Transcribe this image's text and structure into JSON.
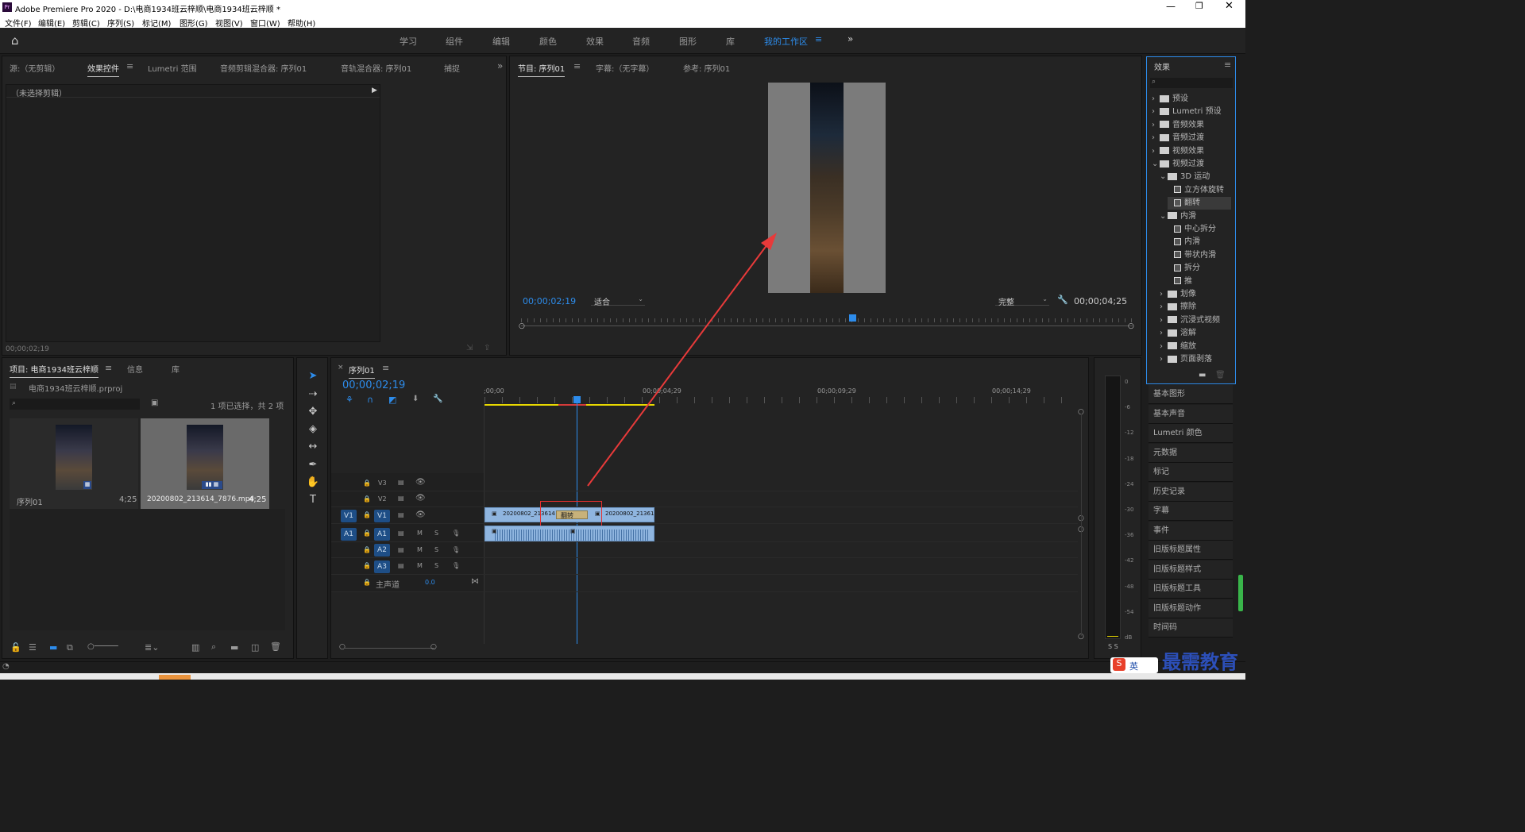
{
  "app": {
    "title": "Adobe Premiere Pro 2020 - D:\\电商1934班云梓顺\\电商1934班云梓顺 *",
    "menus": [
      "文件(F)",
      "编辑(E)",
      "剪辑(C)",
      "序列(S)",
      "标记(M)",
      "图形(G)",
      "视图(V)",
      "窗口(W)",
      "帮助(H)"
    ]
  },
  "workspaces": {
    "tabs": [
      "学习",
      "组件",
      "编辑",
      "颜色",
      "效果",
      "音频",
      "图形",
      "库"
    ],
    "active": "我的工作区",
    "more": "»"
  },
  "source_panel": {
    "tabs": [
      "源:（无剪辑）",
      "效果控件",
      "Lumetri 范围",
      "音频剪辑混合器: 序列01",
      "音轨混合器: 序列01",
      "捕捉"
    ],
    "no_clip": "（未选择剪辑）",
    "timecode": "00;00;02;19"
  },
  "program_panel": {
    "tabs": [
      "节目: 序列01",
      "字幕:（无字幕）",
      "参考: 序列01"
    ],
    "timecode": "00;00;02;19",
    "fit": "适合",
    "quality": "完整",
    "duration": "00;00;04;25"
  },
  "effects_panel": {
    "title": "效果",
    "items": [
      {
        "label": "预设",
        "kind": "folder",
        "level": 0,
        "open": false
      },
      {
        "label": "Lumetri 预设",
        "kind": "folder",
        "level": 0,
        "open": false
      },
      {
        "label": "音频效果",
        "kind": "folder",
        "level": 0,
        "open": false
      },
      {
        "label": "音频过渡",
        "kind": "folder",
        "level": 0,
        "open": false
      },
      {
        "label": "视频效果",
        "kind": "folder",
        "level": 0,
        "open": false
      },
      {
        "label": "视频过渡",
        "kind": "folder",
        "level": 0,
        "open": true
      },
      {
        "label": "3D 运动",
        "kind": "folder",
        "level": 1,
        "open": true
      },
      {
        "label": "立方体旋转",
        "kind": "effect",
        "level": 2
      },
      {
        "label": "翻转",
        "kind": "effect",
        "level": 2,
        "selected": true
      },
      {
        "label": "内滑",
        "kind": "folder",
        "level": 1,
        "open": true
      },
      {
        "label": "中心拆分",
        "kind": "effect",
        "level": 2
      },
      {
        "label": "内滑",
        "kind": "effect",
        "level": 2
      },
      {
        "label": "带状内滑",
        "kind": "effect",
        "level": 2
      },
      {
        "label": "拆分",
        "kind": "effect",
        "level": 2
      },
      {
        "label": "推",
        "kind": "effect",
        "level": 2
      },
      {
        "label": "划像",
        "kind": "folder",
        "level": 1,
        "open": false
      },
      {
        "label": "擦除",
        "kind": "folder",
        "level": 1,
        "open": false
      },
      {
        "label": "沉浸式视频",
        "kind": "folder",
        "level": 1,
        "open": false
      },
      {
        "label": "溶解",
        "kind": "folder",
        "level": 1,
        "open": false
      },
      {
        "label": "缩放",
        "kind": "folder",
        "level": 1,
        "open": false
      },
      {
        "label": "页面剥落",
        "kind": "folder",
        "level": 1,
        "open": false
      }
    ]
  },
  "side_panels": [
    "基本图形",
    "基本声音",
    "Lumetri 颜色",
    "元数据",
    "标记",
    "历史记录",
    "字幕",
    "事件",
    "旧版标题属性",
    "旧版标题样式",
    "旧版标题工具",
    "旧版标题动作",
    "时间码"
  ],
  "project_panel": {
    "tabs": [
      "项目: 电商1934班云梓顺",
      "信息",
      "库"
    ],
    "file": "电商1934班云梓顺.prproj",
    "selection": "1 项已选择，共 2 项",
    "items": [
      {
        "name": "序列01",
        "duration": "4;25"
      },
      {
        "name": "20200802_213614_7876.mp4",
        "duration": "4;25"
      }
    ]
  },
  "timeline": {
    "tab": "序列01",
    "timecode": "00;00;02;19",
    "ruler": [
      ";00;00",
      "00;00;04;29",
      "00;00;09;29",
      "00;00;14;29"
    ],
    "video_tracks": [
      "V3",
      "V2",
      "V1"
    ],
    "audio_tracks": [
      "A1",
      "A2",
      "A3"
    ],
    "master": "主声道",
    "master_val": "0.0",
    "clip_left": "20200802_213614",
    "clip_right": "20200802_21361",
    "transition": "翻转"
  },
  "meter": {
    "labels": [
      "0",
      "-6",
      "-12",
      "-18",
      "-24",
      "-30",
      "-36",
      "-42",
      "-48",
      "-54",
      "dB"
    ],
    "solo": "S S"
  },
  "watermark": "最需教育",
  "ime": "英"
}
